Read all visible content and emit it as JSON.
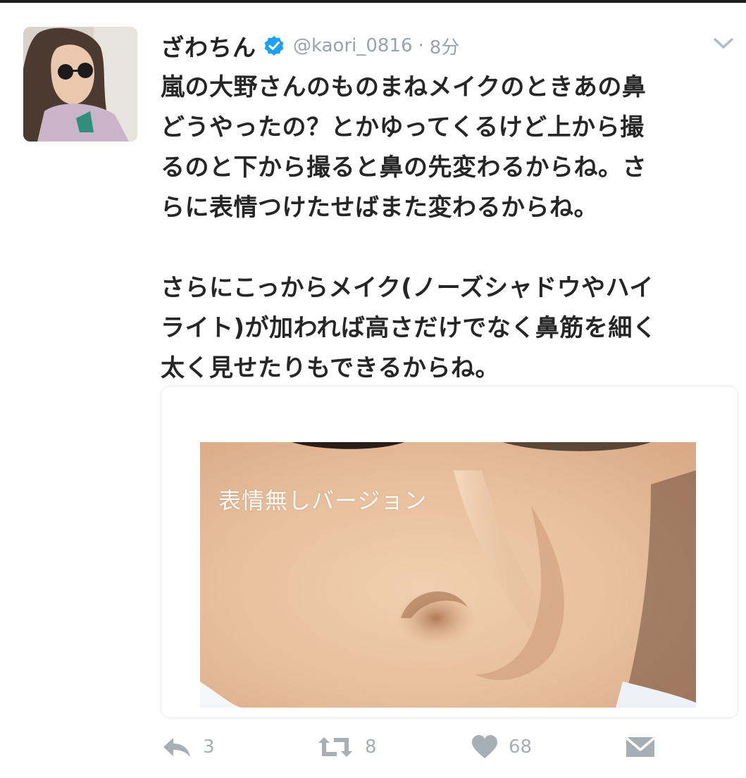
{
  "tweet": {
    "display_name": "ざわちん",
    "handle": "@kaori_0816",
    "separator": "·",
    "time": "8分",
    "text_paragraphs": [
      "嵐の大野さんのものまねメイクのときあの鼻\nどうやったの？とかゆってくるけど上から撮\nるのと下から撮ると鼻の先変わるからね。さ\nらに表情つけたせばまた変わるからね。",
      "さらにこっからメイク(ノーズシャドウやハイ\nライト)が加われば高さだけでなく鼻筋を細く\n太く見せたりもできるからね。"
    ],
    "media_caption": "表情無しバージョン",
    "actions": {
      "reply_count": "3",
      "retweet_count": "8",
      "like_count": "68"
    }
  },
  "icons": {
    "verified": "verified-badge-icon",
    "menu": "chevron-down-icon",
    "reply": "reply-icon",
    "retweet": "retweet-icon",
    "like": "heart-icon",
    "dm": "envelope-icon"
  },
  "colors": {
    "verified_blue": "#1da1f2",
    "meta_gray": "#9aa3ab",
    "action_gray": "#a6aeb6"
  }
}
